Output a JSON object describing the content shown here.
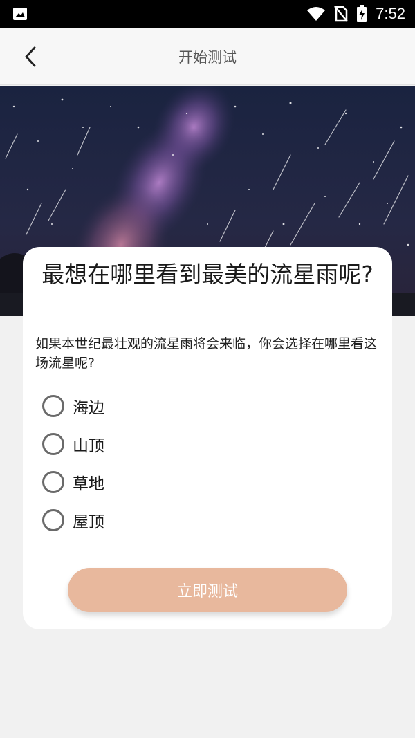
{
  "status_bar": {
    "time": "7:52",
    "icons": [
      "image-icon",
      "wifi-icon",
      "no-sim-icon",
      "battery-charging-icon"
    ]
  },
  "app_bar": {
    "title": "开始测试",
    "back_icon": "chevron-left-icon"
  },
  "hero": {
    "image": "starry-night-meteor-shower"
  },
  "question": {
    "title": "最想在哪里看到最美的流星雨呢?",
    "description": "如果本世纪最壮观的流星雨将会来临，你会选择在哪里看这场流星呢?",
    "options": [
      {
        "label": "海边",
        "selected": false
      },
      {
        "label": "山顶",
        "selected": false
      },
      {
        "label": "草地",
        "selected": false
      },
      {
        "label": "屋顶",
        "selected": false
      }
    ],
    "submit_label": "立即测试"
  },
  "colors": {
    "accent": "#e8b89d",
    "status_bar": "#000000",
    "background": "#f1f1f1"
  }
}
